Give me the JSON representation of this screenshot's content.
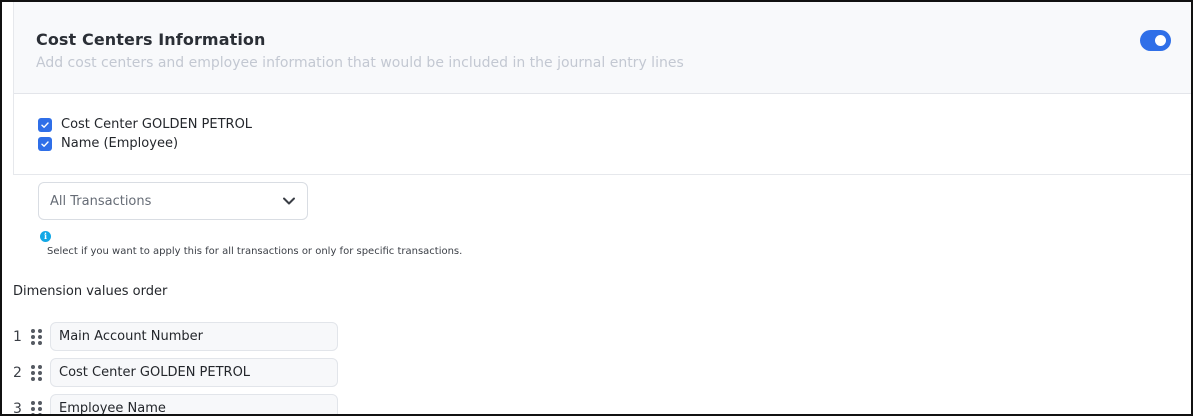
{
  "section": {
    "title": "Cost Centers Information",
    "subtitle": "Add cost centers and employee information that would be included in the journal entry lines",
    "toggle_on": true,
    "accent_color": "#2f6fe8"
  },
  "checkboxes": [
    {
      "label": "Cost Center GOLDEN PETROL",
      "checked": true
    },
    {
      "label": "Name (Employee)",
      "checked": true
    }
  ],
  "transactions_select": {
    "value": "All Transactions",
    "icon": "chevron-down-icon"
  },
  "info": {
    "icon": "info-icon",
    "glyph": "i",
    "hint": "Select if you want to apply this for all transactions or only for specific transactions."
  },
  "dimension_order": {
    "label": "Dimension values order",
    "items": [
      {
        "index": "1",
        "value": "Main Account Number"
      },
      {
        "index": "2",
        "value": "Cost Center GOLDEN PETROL"
      },
      {
        "index": "3",
        "value": "Employee Name"
      }
    ]
  }
}
